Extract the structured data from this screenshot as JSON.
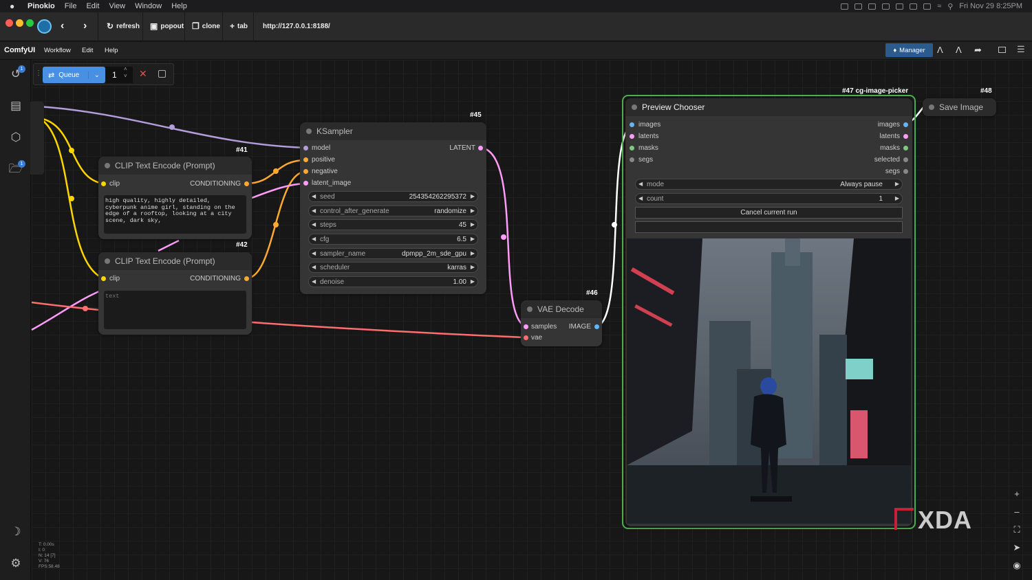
{
  "macos_menu": {
    "app": "Pinokio",
    "items": [
      "File",
      "Edit",
      "View",
      "Window",
      "Help"
    ],
    "clock": "Fri Nov 29  8:25PM"
  },
  "browser": {
    "buttons": [
      "refresh",
      "popout",
      "clone",
      "tab"
    ],
    "url": "http://127.0.0.1:8188/"
  },
  "app_menu": {
    "brand": "ComfyUI",
    "items": [
      "Workflow",
      "Edit",
      "Help"
    ],
    "manager": "Manager"
  },
  "sidebar": {
    "history_badge": "1",
    "folder_badge": "1"
  },
  "queue": {
    "label": "Queue",
    "count": "1"
  },
  "stats": [
    "T: 0.00s",
    "I: 0",
    "N: 14 [7]",
    "V: 76",
    "FPS:58.48"
  ],
  "nodes": {
    "ksampler": {
      "id": "#45",
      "title": "KSampler",
      "inputs": [
        "model",
        "positive",
        "negative",
        "latent_image"
      ],
      "output": "LATENT",
      "widgets": [
        {
          "label": "seed",
          "value": "254354262295372"
        },
        {
          "label": "control_after_generate",
          "value": "randomize"
        },
        {
          "label": "steps",
          "value": "45"
        },
        {
          "label": "cfg",
          "value": "6.5"
        },
        {
          "label": "sampler_name",
          "value": "dpmpp_2m_sde_gpu"
        },
        {
          "label": "scheduler",
          "value": "karras"
        },
        {
          "label": "denoise",
          "value": "1.00"
        }
      ]
    },
    "clip1": {
      "id": "#41",
      "title": "CLIP Text Encode (Prompt)",
      "input": "clip",
      "output": "CONDITIONING",
      "text": "high quality, highly detailed,\ncyberpunk anime girl, standing on the\nedge of a rooftop, looking at a city\nscene, dark sky,"
    },
    "clip2": {
      "id": "#42",
      "title": "CLIP Text Encode (Prompt)",
      "input": "clip",
      "output": "CONDITIONING",
      "placeholder": "text"
    },
    "vae": {
      "id": "#46",
      "title": "VAE Decode",
      "inputs": [
        "samples",
        "vae"
      ],
      "output": "IMAGE"
    },
    "chooser": {
      "id": "#47 cg-image-picker",
      "title": "Preview Chooser",
      "inputs": [
        "images",
        "latents",
        "masks",
        "segs"
      ],
      "outputs": [
        "images",
        "latents",
        "masks",
        "selected",
        "segs"
      ],
      "mode_label": "mode",
      "mode_value": "Always pause",
      "count_label": "count",
      "count_value": "1",
      "cancel": "Cancel current run"
    },
    "save": {
      "id": "#48",
      "title": "Save Image"
    }
  },
  "watermark": "XDA",
  "colors": {
    "accent": "#4a90e2",
    "manager": "#2b5a8c",
    "selected_border": "#4caf50",
    "model": "#b39ddb",
    "clip": "#ffd500",
    "conditioning": "#ffa931",
    "latent": "#ff9cf9",
    "vae": "#ff6e6e",
    "image": "#64b5f6"
  }
}
